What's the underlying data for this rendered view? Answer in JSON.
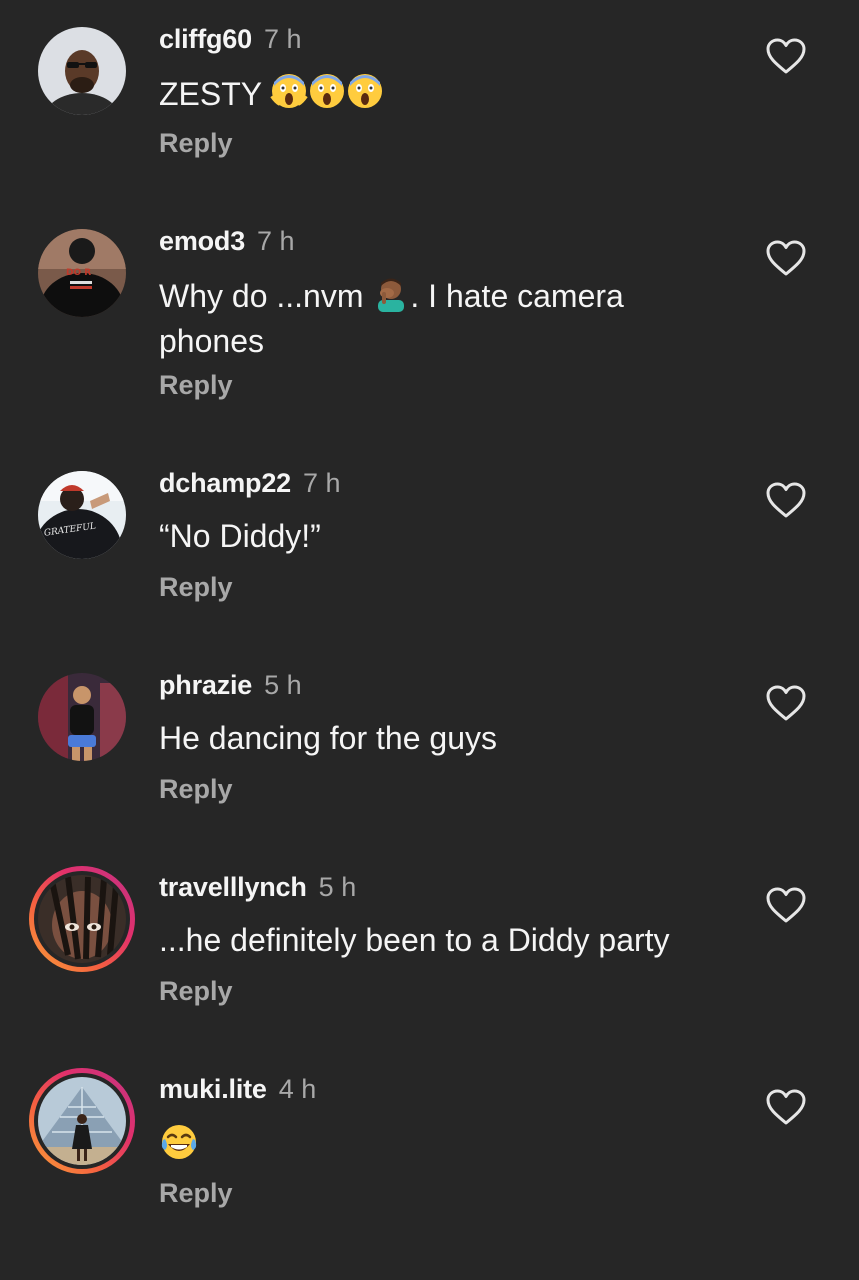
{
  "reply_label": "Reply",
  "colors": {
    "background": "#262626",
    "text_primary": "#f5f5f5",
    "text_secondary": "#a8a8a8",
    "story_ring": [
      "#f9a23a",
      "#f56040",
      "#e1306c",
      "#c13584"
    ]
  },
  "comments": [
    {
      "username": "cliffg60",
      "time": "7 h",
      "text": "ZESTY",
      "emoji": [
        "screaming-face",
        "screaming-face",
        "screaming-face"
      ],
      "avatar_story_ring": false
    },
    {
      "username": "emod3",
      "time": "7 h",
      "text_before": "Why do ...nvm",
      "text_after": ". I hate camera phones",
      "emoji": [
        "face-palm"
      ],
      "avatar_story_ring": false
    },
    {
      "username": "dchamp22",
      "time": "7 h",
      "text": "“No Diddy!”",
      "avatar_story_ring": false,
      "avatar_caption": "GRATEFUL"
    },
    {
      "username": "phrazie",
      "time": "5 h",
      "text": "He dancing for the guys",
      "avatar_story_ring": false
    },
    {
      "username": "travelllynch",
      "time": "5 h",
      "text": "...he definitely been to a Diddy party",
      "avatar_story_ring": true
    },
    {
      "username": "muki.lite",
      "time": "4 h",
      "text": "",
      "emoji": [
        "tears-of-joy"
      ],
      "avatar_story_ring": true
    }
  ]
}
